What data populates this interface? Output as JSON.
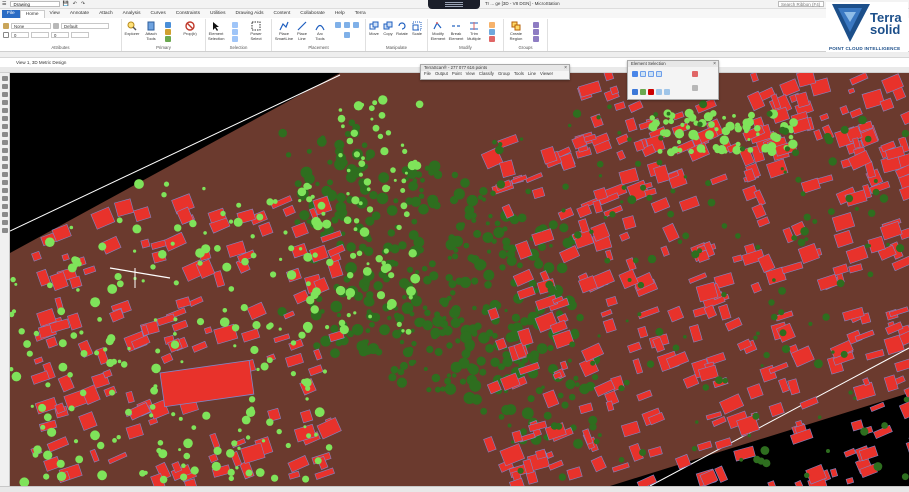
{
  "titlebar": {
    "workspace": "Drawing",
    "window_title": "Tr ... ge [3D - V8 DGN] - MicroStation",
    "search_placeholder": "Search Ribbon (F4)"
  },
  "ribbon_tabs": [
    "File",
    "Home",
    "View",
    "Annotate",
    "Attach",
    "Analysis",
    "Curves",
    "Constraints",
    "Utilities",
    "Drawing Aids",
    "Content",
    "Collaborate",
    "Help",
    "Terra"
  ],
  "active_tab": "Home",
  "attributes": {
    "level": "None",
    "color": "0",
    "text_style": "Default",
    "weight": "0"
  },
  "ribbon_groups": {
    "attributes": "Attributes",
    "primary": "Primary",
    "selection": "Selection",
    "placement": "Placement",
    "manipulate": "Manipulate",
    "modify": "Modify",
    "groups": "Groups"
  },
  "ribbon_buttons": {
    "explorer": "Explorer",
    "attach_tools": "Attach Tools",
    "prop": "Prop(b)",
    "element_selection": "Element Selection",
    "power_select": "Power Select",
    "place_smartline": "Place SmartLine",
    "place_line": "Place Line",
    "arc_tools": "Arc Tools",
    "move": "Move",
    "copy": "Copy",
    "rotate": "Rotate",
    "scale": "Scale",
    "modify_element": "Modify Element",
    "break_element": "Break Element",
    "trim_multiple": "Trim Multiple",
    "create_region": "Create Region"
  },
  "logo": {
    "line1": "Terra",
    "line2": "solid",
    "tagline": "POINT CLOUD INTELLIGENCE"
  },
  "view": {
    "title": "View 1, 3D Metric Design"
  },
  "terrascan_window": {
    "title": "TerraScan® - 277 077 616 points",
    "menu": [
      "File",
      "Output",
      "Point",
      "View",
      "Classify",
      "Group",
      "Tools",
      "Line",
      "Viewer"
    ]
  },
  "power_selection_window": {
    "title": "Element Selection"
  },
  "colors": {
    "building": "#e8322b",
    "high_vegetation": "#2e6e1f",
    "low_vegetation": "#7fe35a",
    "ground": "#6b3a2e",
    "wall": "#7f87c8",
    "background": "#000000"
  }
}
